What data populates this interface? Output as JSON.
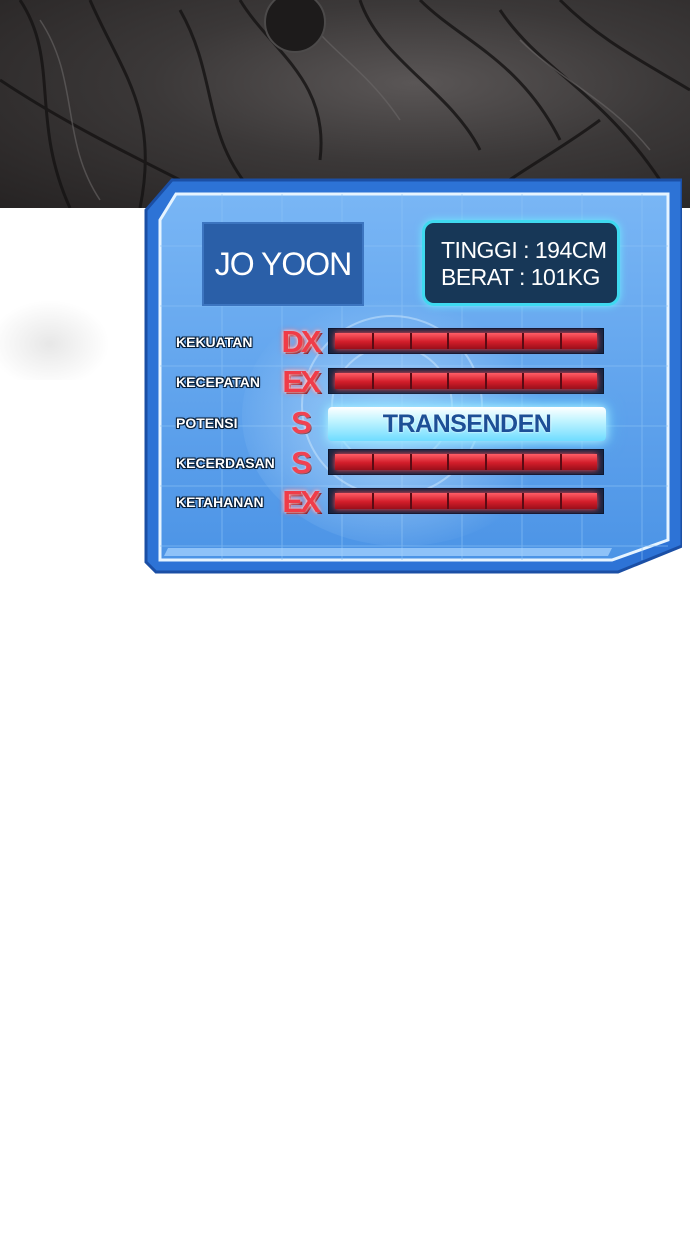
{
  "profile": {
    "name": "JO YOON",
    "height_line": "TINGGI : 194CM",
    "weight_line": "BERAT : 101KG"
  },
  "stats": [
    {
      "label": "KEKUATAN",
      "grade": "DX",
      "bar_fill": 1.0
    },
    {
      "label": "KECEPATAN",
      "grade": "EX",
      "bar_fill": 1.0
    },
    {
      "label": "POTENSI",
      "grade": "S",
      "value_text": "TRANSENDEN"
    },
    {
      "label": "KECERDASAN",
      "grade": "S",
      "bar_fill": 1.0
    },
    {
      "label": "KETAHANAN",
      "grade": "EX",
      "bar_fill": 1.0
    }
  ],
  "colors": {
    "panel_blue": "#5aa3ee",
    "panel_border": "#2a6fd0",
    "bar_red": "#e0303c",
    "grade_red": "#f03c48",
    "transcend_glow": "#8fe8ff"
  }
}
